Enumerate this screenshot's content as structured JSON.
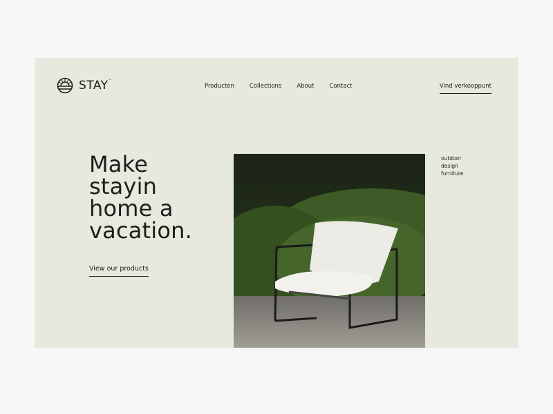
{
  "brand": {
    "name": "STAY",
    "trademark": "™"
  },
  "nav": {
    "items": [
      "Producten",
      "Collections",
      "About",
      "Contact"
    ],
    "cta": "Vind verkooppunt"
  },
  "hero": {
    "lines": [
      "Make",
      "stayin",
      "home a",
      "vacation."
    ],
    "link": "View our products"
  },
  "tagline": [
    "outdoor",
    "design",
    "furniture"
  ],
  "colors": {
    "background": "#e8e9de",
    "text": "#1c1c1a"
  }
}
